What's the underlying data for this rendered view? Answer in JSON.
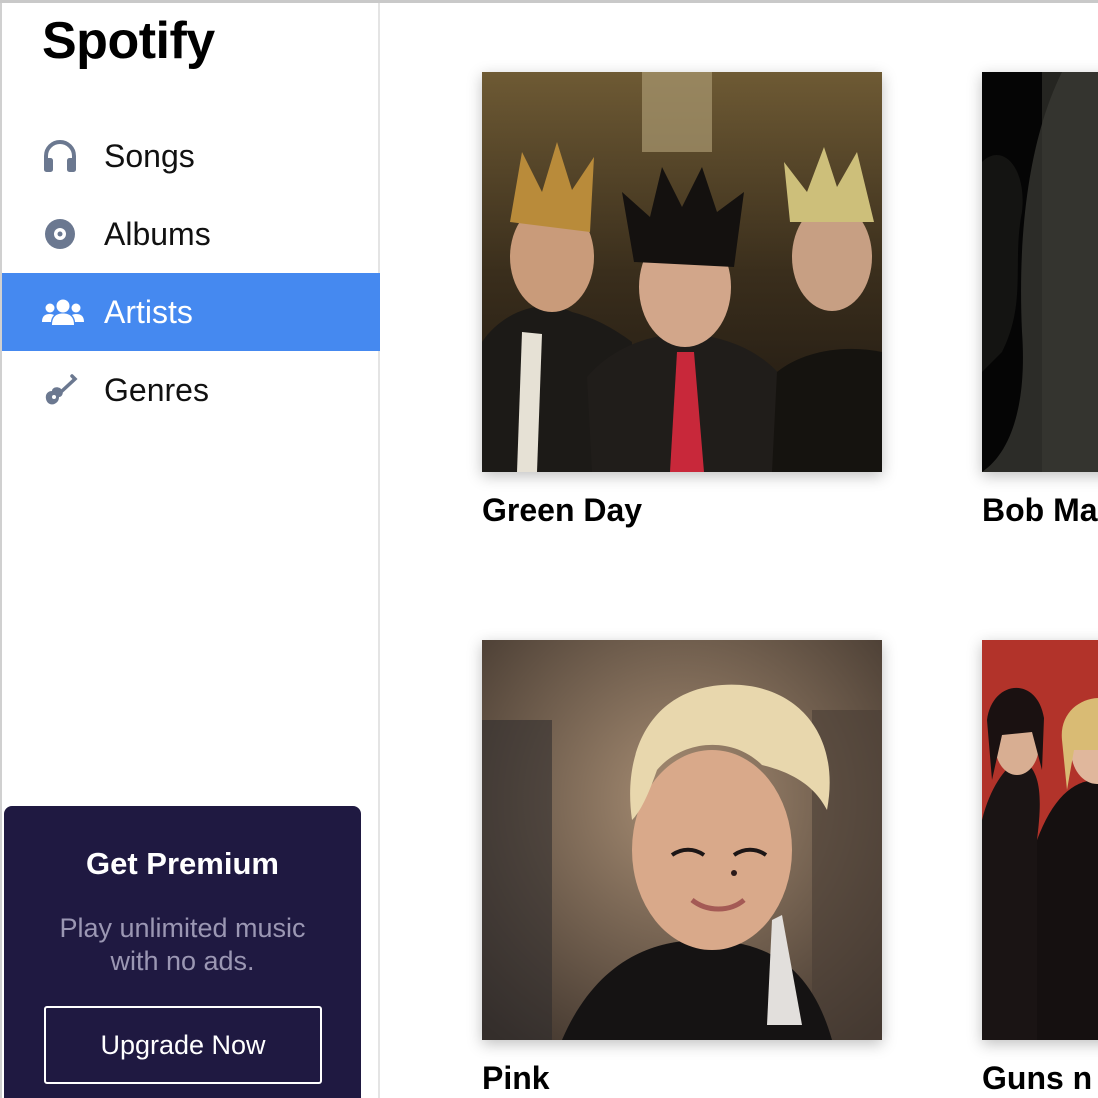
{
  "app": {
    "title": "Spotify"
  },
  "sidebar": {
    "items": [
      {
        "label": "Songs",
        "icon": "headphones-icon",
        "active": false
      },
      {
        "label": "Albums",
        "icon": "disc-icon",
        "active": false
      },
      {
        "label": "Artists",
        "icon": "users-icon",
        "active": true
      },
      {
        "label": "Genres",
        "icon": "guitar-icon",
        "active": false
      }
    ]
  },
  "premium": {
    "title": "Get Premium",
    "description": "Play unlimited music with no ads.",
    "button_label": "Upgrade Now"
  },
  "artists": [
    {
      "name": "Green Day"
    },
    {
      "name": "Bob Ma"
    },
    {
      "name": "Pink"
    },
    {
      "name": "Guns n"
    }
  ],
  "colors": {
    "accent": "#4589f0",
    "icon": "#6b7890",
    "premium_bg": "#1f1941",
    "premium_desc": "#9b97b3"
  }
}
